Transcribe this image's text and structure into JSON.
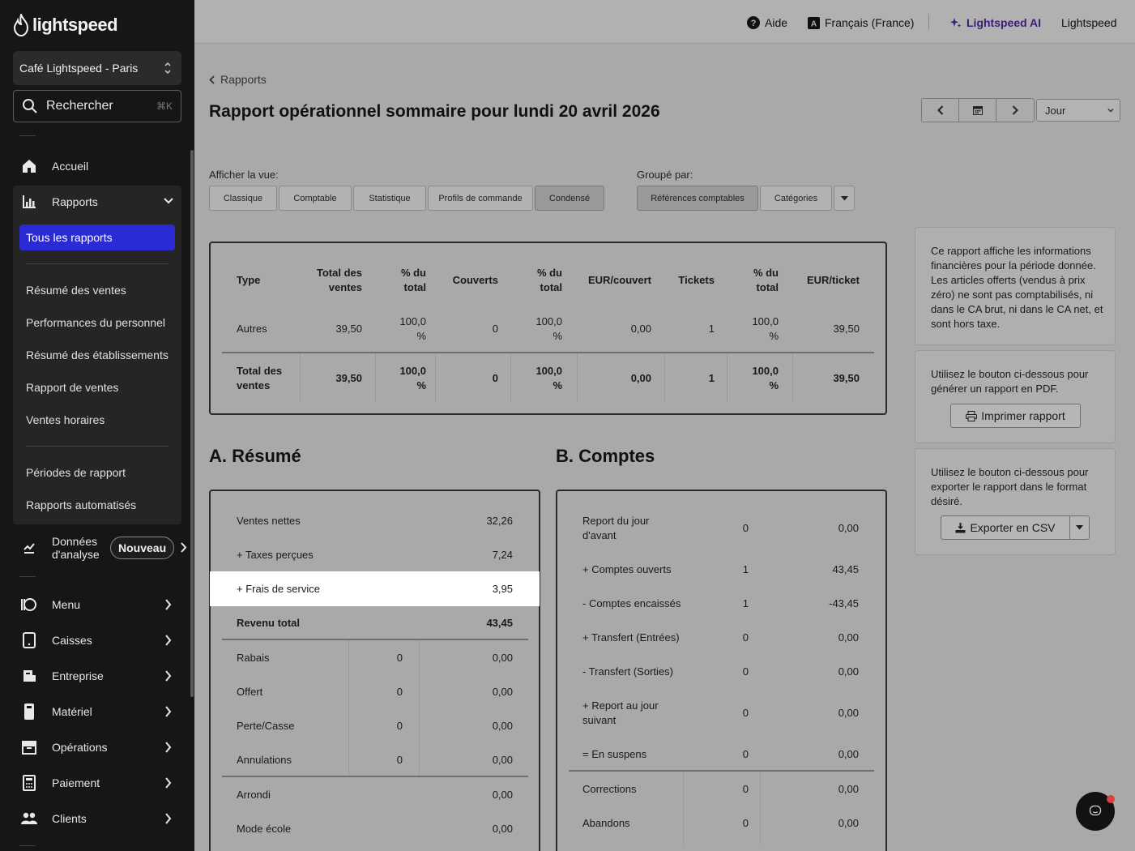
{
  "sidebar": {
    "brand": "lightspeed",
    "venue": "Café Lightspeed - Paris",
    "search_label": "Rechercher",
    "search_shortcut": "⌘K",
    "home": "Accueil",
    "reports": "Rapports",
    "reports_sub": {
      "all": "Tous les rapports",
      "items": [
        "Résumé des ventes",
        "Performances du personnel",
        "Résumé des établissements",
        "Rapport de ventes",
        "Ventes horaires"
      ],
      "items2": [
        "Périodes de rapport",
        "Rapports automatisés"
      ]
    },
    "analytics": "Données d'analyse",
    "analytics_line1": "Données",
    "analytics_line2": "d'analyse",
    "new_badge": "Nouveau",
    "nav": [
      "Menu",
      "Caisses",
      "Entreprise",
      "Matériel",
      "Opérations",
      "Paiement",
      "Clients"
    ]
  },
  "topbar": {
    "help": "Aide",
    "language": "Français (France)",
    "ai": "Lightspeed AI",
    "account": "Lightspeed"
  },
  "main": {
    "breadcrumb": "Rapports",
    "title": "Rapport opérationnel sommaire pour lundi 20 avril 2026",
    "period": "Jour",
    "view_label": "Afficher la vue:",
    "views": [
      "Classique",
      "Comptable",
      "Statistique",
      "Profils de commande",
      "Condensé"
    ],
    "selected_view": "Condensé",
    "group_label": "Groupé par:",
    "groups": [
      "Références comptables",
      "Catégories"
    ],
    "selected_group": "Références comptables"
  },
  "summary_table": {
    "headers": {
      "type": "Type",
      "total_sales_1": "Total des",
      "total_sales_2": "ventes",
      "pct1_1": "% du",
      "pct1_2": "total",
      "covers": "Couverts",
      "pct2_1": "% du",
      "pct2_2": "total",
      "eur_cover": "EUR/couvert",
      "tickets": "Tickets",
      "pct3_1": "% du",
      "pct3_2": "total",
      "eur_ticket": "EUR/ticket"
    },
    "row": {
      "type": "Autres",
      "sales": "39,50",
      "pct1_1": "100,0",
      "pct1_2": "%",
      "covers": "0",
      "pct2_1": "100,0",
      "pct2_2": "%",
      "eur_cover": "0,00",
      "tickets": "1",
      "pct3_1": "100,0",
      "pct3_2": "%",
      "eur_ticket": "39,50"
    },
    "total": {
      "label_1": "Total des",
      "label_2": "ventes",
      "sales": "39,50",
      "pct1_1": "100,0",
      "pct1_2": "%",
      "covers": "0",
      "pct2_1": "100,0",
      "pct2_2": "%",
      "eur_cover": "0,00",
      "tickets": "1",
      "pct3_1": "100,0",
      "pct3_2": "%",
      "eur_ticket": "39,50"
    }
  },
  "resume": {
    "heading": "A. Résumé",
    "rows": [
      {
        "label": "Ventes nettes",
        "count": "",
        "value": "32,26"
      },
      {
        "label": "+ Taxes perçues",
        "count": "",
        "value": "7,24"
      },
      {
        "label": "+ Frais de service",
        "count": "",
        "value": "3,95"
      },
      {
        "label": "Revenu total",
        "count": "",
        "value": "43,45"
      },
      {
        "label": "Rabais",
        "count": "0",
        "value": "0,00"
      },
      {
        "label": "Offert",
        "count": "0",
        "value": "0,00"
      },
      {
        "label": "Perte/Casse",
        "count": "0",
        "value": "0,00"
      },
      {
        "label": "Annulations",
        "count": "0",
        "value": "0,00"
      },
      {
        "label": "Arrondi",
        "count": "",
        "value": "0,00"
      },
      {
        "label": "Mode école",
        "count": "",
        "value": "0,00"
      }
    ]
  },
  "comptes": {
    "heading": "B. Comptes",
    "rows": [
      {
        "label_1": "Report du jour",
        "label_2": "d'avant",
        "count": "0",
        "value": "0,00"
      },
      {
        "label_1": "+ Comptes ouverts",
        "label_2": "",
        "count": "1",
        "value": "43,45"
      },
      {
        "label_1": "- Comptes encaissés",
        "label_2": "",
        "count": "1",
        "value": "-43,45"
      },
      {
        "label_1": "+ Transfert (Entrées)",
        "label_2": "",
        "count": "0",
        "value": "0,00"
      },
      {
        "label_1": "- Transfert (Sorties)",
        "label_2": "",
        "count": "0",
        "value": "0,00"
      },
      {
        "label_1": "+ Report au jour",
        "label_2": "suivant",
        "count": "0",
        "value": "0,00"
      },
      {
        "label_1": "= En suspens",
        "label_2": "",
        "count": "0",
        "value": "0,00"
      },
      {
        "label_1": "Corrections",
        "label_2": "",
        "count": "0",
        "value": "0,00"
      },
      {
        "label_1": "Abandons",
        "label_2": "",
        "count": "0",
        "value": "0,00"
      }
    ]
  },
  "info": {
    "note_lines": [
      "Ce rapport affiche les informations",
      "financières pour la période donnée.",
      "Les articles offerts (vendus à prix",
      "zéro) ne sont pas comptabilisés, ni",
      "dans le CA brut, ni dans le CA net, et",
      "sont hors taxe."
    ],
    "pdf_lines": [
      "Utilisez le bouton ci-dessous pour",
      "générer un rapport en PDF."
    ],
    "print_label": "Imprimer rapport",
    "csv_lines": [
      "Utilisez le bouton ci-dessous pour",
      "exporter le rapport dans le format",
      "désiré."
    ],
    "csv_label": "Exporter en CSV"
  },
  "colors": {
    "sidebar_bg": "#161616",
    "active_item": "#2b2bd3",
    "ai_purple": "#3a1e7a",
    "notification": "#d94040"
  }
}
